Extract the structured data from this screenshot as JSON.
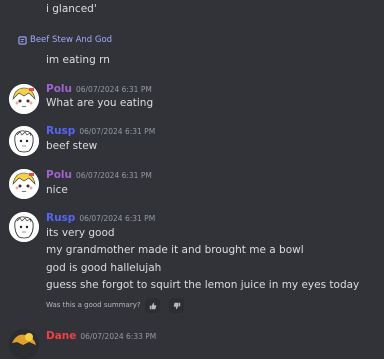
{
  "top_message": "i glanced'",
  "thread": {
    "icon": "thread-icon",
    "label": "Beef Stew And God"
  },
  "thread_message": "im eating rn",
  "colors": {
    "polu": "#a061d1",
    "rusp": "#5865f2",
    "dane": "#f23f43",
    "link": "#a3a9ff"
  },
  "messages": [
    {
      "author": "Polu",
      "timestamp": "06/07/2024 6:31 PM",
      "lines": [
        "What are you eating"
      ]
    },
    {
      "author": "Rusp",
      "timestamp": "06/07/2024 6:31 PM",
      "lines": [
        "beef stew"
      ]
    },
    {
      "author": "Polu",
      "timestamp": "06/07/2024 6:31 PM",
      "lines": [
        "nice"
      ]
    },
    {
      "author": "Rusp",
      "timestamp": "06/07/2024 6:31 PM",
      "lines": [
        "its very good",
        "my grandmother made it and brought me a bowl",
        "god is good hallelujah",
        "guess she forgot to squirt the lemon juice in my eyes today"
      ]
    },
    {
      "author": "Dane",
      "timestamp": "06/07/2024 6:33 PM",
      "lines": []
    }
  ],
  "summary_feedback": {
    "question": "Was this a good summary?",
    "up_icon": "thumbs-up-icon",
    "down_icon": "thumbs-down-icon"
  }
}
